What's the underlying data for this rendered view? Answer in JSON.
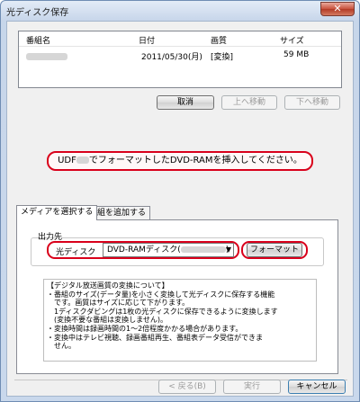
{
  "window": {
    "title": "光ディスク保存",
    "close_symbol": "✕"
  },
  "list": {
    "headers": [
      "番組名",
      "日付",
      "画質",
      "サイズ"
    ],
    "row": {
      "date": "2011/05/30(月)",
      "quality": "[変換]",
      "size": "59 MB"
    }
  },
  "list_buttons": {
    "cancel": "取消",
    "move_up": "上へ移動",
    "move_down": "下へ移動"
  },
  "message": {
    "prefix": "UDF",
    "suffix": "でフォーマットしたDVD-RAMを挿入してください。"
  },
  "tabs": [
    {
      "label": "メディアを選択する"
    },
    {
      "label": "番組を追加する"
    }
  ],
  "output": {
    "label": "出力先",
    "drive_label": "光ディスク",
    "drive_value": "DVD-RAMディスク(",
    "drive_close": ")",
    "format_button": "フォーマット"
  },
  "notes": [
    "【デジタル放送画質の変換について】",
    "・番組のサイズ(データ量)を小さく変換して光ディスクに保存する機能",
    "　です。画質はサイズに応じて下がります。",
    "　1ディスクダビングは1枚の光ディスクに保存できるように変換します",
    "　(変換不要な番組は変換しません)。",
    "・変換時間は録画時間の1〜2倍程度かかる場合があります。",
    "・変換中はテレビ視聴、録画番組再生、番組表データ受信ができま",
    "　せん。"
  ],
  "footer": {
    "back": "< 戻る(B)",
    "run": "実行",
    "cancel": "キャンセル"
  }
}
